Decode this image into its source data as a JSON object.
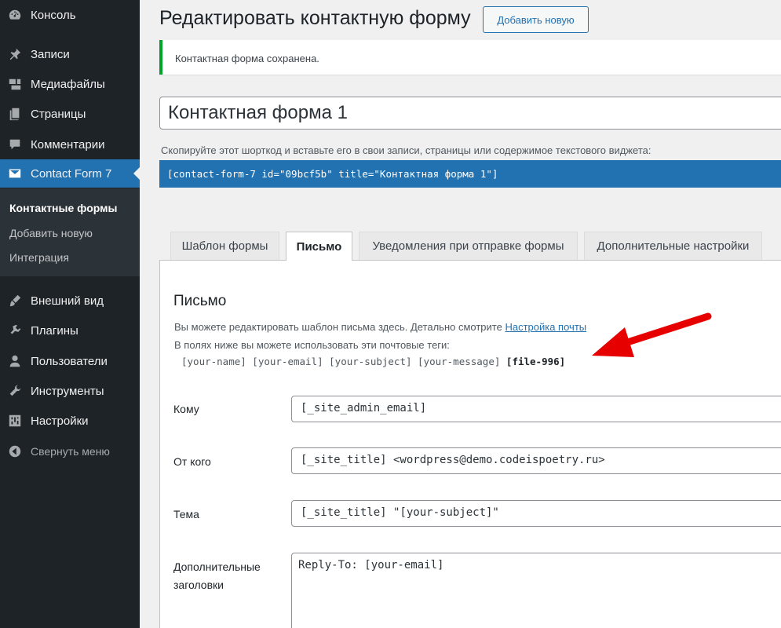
{
  "sidebar": {
    "items": [
      {
        "label": "Консоль",
        "icon": "dashboard-icon"
      },
      {
        "label": "Записи",
        "icon": "pin-icon"
      },
      {
        "label": "Медиафайлы",
        "icon": "media-icon"
      },
      {
        "label": "Страницы",
        "icon": "pages-icon"
      },
      {
        "label": "Комментарии",
        "icon": "comment-icon"
      },
      {
        "label": "Contact Form 7",
        "icon": "mail-icon"
      },
      {
        "label": "Внешний вид",
        "icon": "brush-icon"
      },
      {
        "label": "Плагины",
        "icon": "plugin-icon"
      },
      {
        "label": "Пользователи",
        "icon": "user-icon"
      },
      {
        "label": "Инструменты",
        "icon": "wrench-icon"
      },
      {
        "label": "Настройки",
        "icon": "settings-icon"
      }
    ],
    "submenu": [
      "Контактные формы",
      "Добавить новую",
      "Интеграция"
    ],
    "collapse_label": "Свернуть меню"
  },
  "header": {
    "title": "Редактировать контактную форму",
    "add_new": "Добавить новую"
  },
  "notice": "Контактная форма сохранена.",
  "form_title": "Контактная форма 1",
  "shortcode_hint": "Скопируйте этот шорткод и вставьте его в свои записи, страницы или содержимое текстового виджета:",
  "shortcode": "[contact-form-7 id=\"09bcf5b\" title=\"Контактная форма 1\"]",
  "tabs": [
    "Шаблон формы",
    "Письмо",
    "Уведомления при отправке формы",
    "Дополнительные настройки"
  ],
  "mail": {
    "heading": "Письмо",
    "desc1": "Вы можете редактировать шаблон письма здесь. Детально смотрите ",
    "desc1_link": "Настройка почты",
    "desc2": "В полях ниже вы можете использовать эти почтовые теги:",
    "tags": "[your-name] [your-email] [your-subject] [your-message] ",
    "tag_highlight": "[file-996]",
    "fields": {
      "to_label": "Кому",
      "to_value": "[_site_admin_email]",
      "from_label": "От кого",
      "from_value": "[_site_title] <wordpress@demo.codeispoetry.ru>",
      "subject_label": "Тема",
      "subject_value": "[_site_title] \"[your-subject]\"",
      "headers_label_1": "Дополнительные",
      "headers_label_2": "заголовки",
      "headers_value": "Reply-To: [your-email]"
    }
  },
  "colors": {
    "accent": "#2271b1",
    "success": "#00a32a",
    "arrow": "#e60000",
    "sidebar": "#1d2327"
  }
}
